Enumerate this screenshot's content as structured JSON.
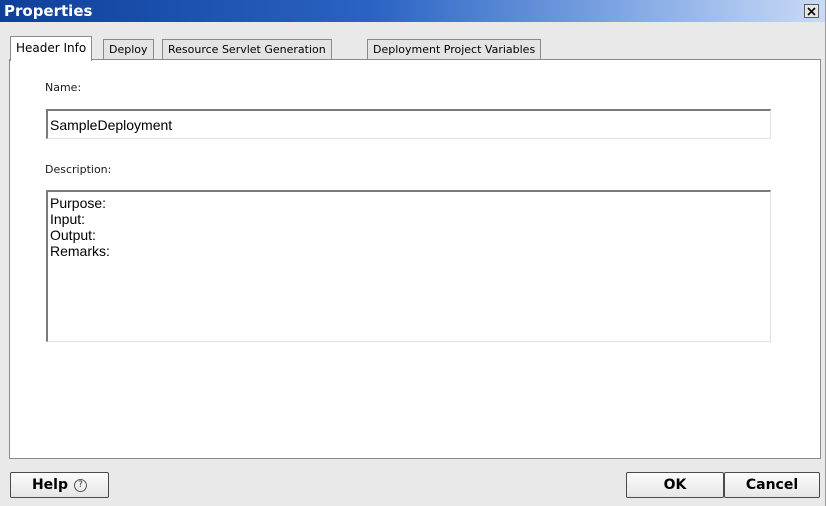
{
  "window": {
    "title": "Properties",
    "close_icon": "close-icon"
  },
  "tabs": [
    {
      "label": "Header Info",
      "active": true
    },
    {
      "label": "Deploy",
      "active": false
    },
    {
      "label": "Resource Servlet Generation",
      "active": false
    },
    {
      "label": "Deployment Project Variables",
      "active": false
    }
  ],
  "form": {
    "name_label": "Name:",
    "name_value": "SampleDeployment",
    "description_label": "Description:",
    "description_lines": [
      "Purpose:",
      "Input:",
      "Output:",
      "Remarks:"
    ]
  },
  "footer": {
    "help_label": "Help",
    "help_icon": "question-circle-icon",
    "ok_label": "OK",
    "cancel_label": "Cancel"
  }
}
